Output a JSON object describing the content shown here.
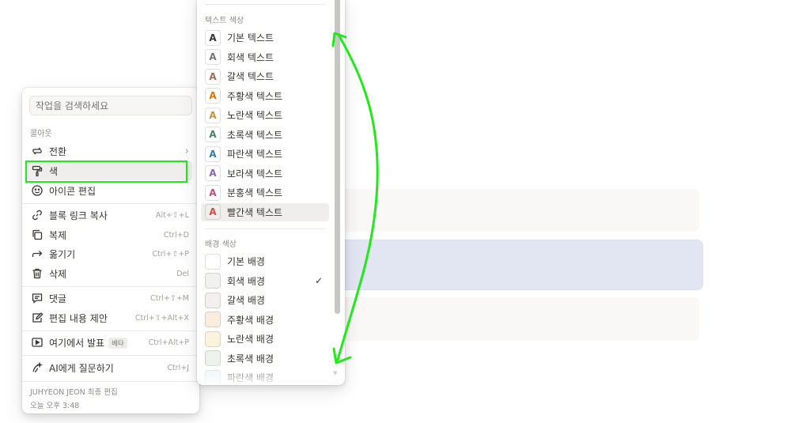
{
  "background_blocks": {
    "top_color": "#f9f8f6",
    "selected_color": "#e1e6f2",
    "bottom_color": "#f9f8f6"
  },
  "block_menu": {
    "search_placeholder": "작업을 검색하세요",
    "section_label": "콜아웃",
    "items": [
      {
        "label": "전환",
        "icon": "turn-into-icon",
        "shortcut": "",
        "has_chevron": true
      },
      {
        "label": "색",
        "icon": "paint-roller-icon",
        "shortcut": "",
        "active": true
      },
      {
        "label": "아이콘 편집",
        "icon": "smiley-icon",
        "shortcut": ""
      },
      {
        "label": "블록 링크 복사",
        "icon": "link-icon",
        "shortcut": "Alt+⇧+L"
      },
      {
        "label": "복제",
        "icon": "duplicate-icon",
        "shortcut": "Ctrl+D"
      },
      {
        "label": "옮기기",
        "icon": "move-arrow-icon",
        "shortcut": "Ctrl+⇧+P"
      },
      {
        "label": "삭제",
        "icon": "trash-icon",
        "shortcut": "Del"
      },
      {
        "label": "댓글",
        "icon": "comment-icon",
        "shortcut": "Ctrl+⇧+M"
      },
      {
        "label": "편집 내용 제안",
        "icon": "suggest-edit-icon",
        "shortcut": "Ctrl+⇧+Alt+X"
      },
      {
        "label": "여기에서 발표",
        "icon": "present-icon",
        "badge": "베타",
        "shortcut": "Ctrl+Alt+P"
      },
      {
        "label": "AI에게 질문하기",
        "icon": "ai-icon",
        "shortcut": "Ctrl+J"
      }
    ],
    "footer": {
      "editor": "JUHYEON JEON 최종 편집",
      "time": "오늘 오후 3:48"
    }
  },
  "color_menu": {
    "text_section_label": "텍스트 색상",
    "text_colors": [
      {
        "label": "기본 텍스트",
        "color": "#37352f"
      },
      {
        "label": "회색 텍스트",
        "color": "#787774"
      },
      {
        "label": "갈색 텍스트",
        "color": "#9f6b53"
      },
      {
        "label": "주황색 텍스트",
        "color": "#d9730d"
      },
      {
        "label": "노란색 텍스트",
        "color": "#cb912f"
      },
      {
        "label": "초록색 텍스트",
        "color": "#448361"
      },
      {
        "label": "파란색 텍스트",
        "color": "#337ea9"
      },
      {
        "label": "보라색 텍스트",
        "color": "#9065b0"
      },
      {
        "label": "분홍색 텍스트",
        "color": "#c14c8a"
      },
      {
        "label": "빨간색 텍스트",
        "color": "#d44c47",
        "hovered": true
      }
    ],
    "glyph": "A",
    "bg_section_label": "배경 색상",
    "bg_colors": [
      {
        "label": "기본 배경",
        "color": "#ffffff"
      },
      {
        "label": "회색 배경",
        "color": "#f1f1ef",
        "checked": true
      },
      {
        "label": "갈색 배경",
        "color": "#f4eeee"
      },
      {
        "label": "주황색 배경",
        "color": "#fbecdd"
      },
      {
        "label": "노란색 배경",
        "color": "#fbf3db"
      },
      {
        "label": "초록색 배경",
        "color": "#edf3ec"
      },
      {
        "label": "파란색 배경",
        "color": "#e7f3f8"
      }
    ],
    "check_mark": "✓"
  },
  "annotations": {
    "highlight_color": "#22e81c"
  }
}
